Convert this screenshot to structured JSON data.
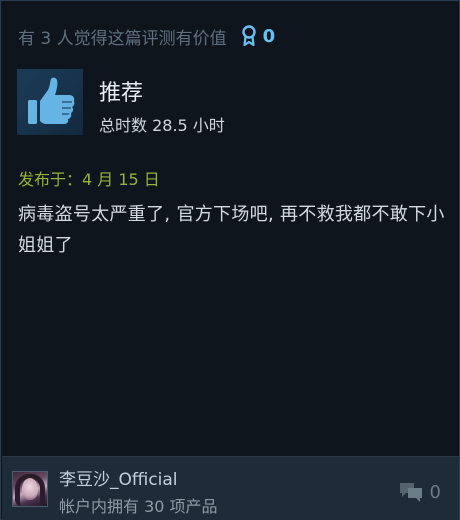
{
  "helpful": {
    "text": "有 3 人觉得这篇评测有价值",
    "award_count": "0",
    "award_icon": "award-ribbon-icon"
  },
  "review": {
    "verdict": "推荐",
    "verdict_icon": "thumbs-up-icon",
    "hours": "总时数 28.5 小时",
    "posted": "发布于：4 月 15 日",
    "body": "病毒盗号太严重了, 官方下场吧, 再不救我都不敢下小姐姐了"
  },
  "author": {
    "name": "李豆沙_Official",
    "products": "帐户内拥有 30 项产品",
    "comment_count": "0",
    "comment_icon": "comment-bubble-icon"
  },
  "colors": {
    "accent_blue": "#66c0f4",
    "posted_green": "#95b33b",
    "background": "#0f151c",
    "footer_bg": "#1e2c3a"
  }
}
